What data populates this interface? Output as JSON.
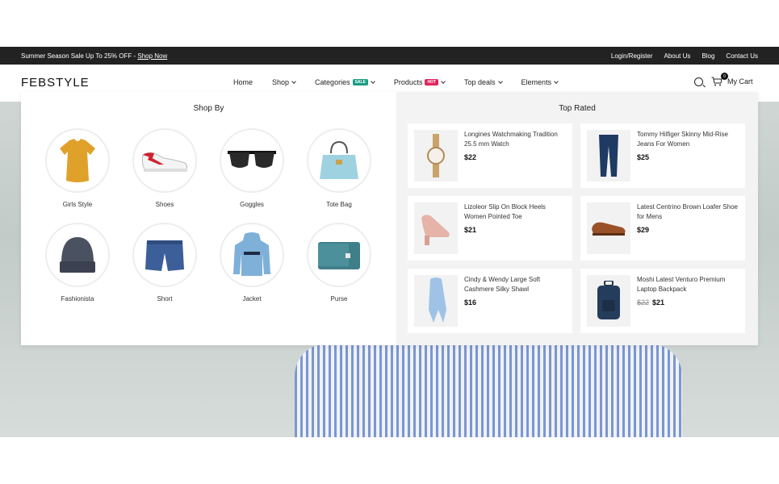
{
  "topbar": {
    "promo_text": "Summer Season Sale Up To 25% OFF - ",
    "promo_link": "Shop Now",
    "links": [
      "Login/Register",
      "About Us",
      "Blog",
      "Contact Us"
    ]
  },
  "header": {
    "logo": "FEBSTYLE",
    "nav": [
      {
        "label": "Home",
        "dropdown": false,
        "badge": ""
      },
      {
        "label": "Shop",
        "dropdown": true,
        "badge": ""
      },
      {
        "label": "Categories",
        "dropdown": true,
        "badge": "SALE"
      },
      {
        "label": "Products",
        "dropdown": true,
        "badge": "HOT"
      },
      {
        "label": "Top deals",
        "dropdown": true,
        "badge": ""
      },
      {
        "label": "Elements",
        "dropdown": true,
        "badge": ""
      }
    ],
    "cart_label": "My Cart",
    "cart_count": "0"
  },
  "mega_menu": {
    "shop_by_title": "Shop By",
    "categories": [
      {
        "label": "Girls Style",
        "icon": "tshirt-icon"
      },
      {
        "label": "Shoes",
        "icon": "sneaker-icon"
      },
      {
        "label": "Goggles",
        "icon": "sunglasses-icon"
      },
      {
        "label": "Tote Bag",
        "icon": "handbag-icon"
      },
      {
        "label": "Fashionista",
        "icon": "beanie-icon"
      },
      {
        "label": "Short",
        "icon": "shorts-icon"
      },
      {
        "label": "Jacket",
        "icon": "hoodie-icon"
      },
      {
        "label": "Purse",
        "icon": "wallet-icon"
      }
    ],
    "top_rated_title": "Top Rated",
    "products": [
      {
        "name": "Longines Watchmaking Tradition 25.5 mm Watch",
        "price": "$22",
        "old_price": "",
        "icon": "watch-icon"
      },
      {
        "name": "Tommy Hilfiger Skinny Mid-Rise Jeans For Women",
        "price": "$25",
        "old_price": "",
        "icon": "jeans-icon"
      },
      {
        "name": "Lizoleor Slip On Block Heels Women Pointed Toe",
        "price": "$21",
        "old_price": "",
        "icon": "heels-icon"
      },
      {
        "name": "Latest Centrino Brown Loafer Shoe for Mens",
        "price": "$29",
        "old_price": "",
        "icon": "loafer-icon"
      },
      {
        "name": "Cindy & Wendy Large Soft Cashmere Silky Shawl",
        "price": "$16",
        "old_price": "",
        "icon": "shawl-icon"
      },
      {
        "name": "Moshi Latest Venturo Premium Laptop Backpack",
        "price": "$21",
        "old_price": "$22",
        "icon": "backpack-icon"
      }
    ]
  },
  "colors": {
    "topbar_bg": "#222222",
    "sale_badge": "#1a9e84",
    "hot_badge": "#e0245e",
    "panel_bg": "#f3f3f3"
  }
}
